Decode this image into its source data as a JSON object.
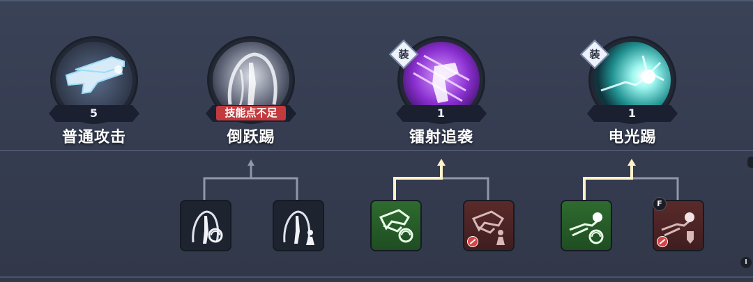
{
  "colors": {
    "background": "#373f53",
    "line_inactive": "#8f97a8",
    "line_active": "#fff2c8",
    "warning": "#c23a3d",
    "node_active": "#2e6b2f",
    "node_locked": "#5a2a2a"
  },
  "skills": [
    {
      "name": "普通攻击",
      "level": "5",
      "icon": "energy-gun-icon",
      "equipped": false
    },
    {
      "name": "倒跃踢",
      "status": "技能点不足",
      "icon": "backflip-kick-icon",
      "equipped": false
    },
    {
      "name": "镭射追袭",
      "level": "1",
      "icon": "laser-pursuit-icon",
      "equipped": true,
      "badge": "装"
    },
    {
      "name": "电光踢",
      "level": "1",
      "icon": "lightning-kick-icon",
      "equipped": true,
      "badge": "装"
    }
  ],
  "branches": [
    {
      "parent": "倒跃踢",
      "nodes": [
        {
          "icon": "backflip-kick-upgrade-icon",
          "state": "available"
        },
        {
          "icon": "backflip-kick-alt-icon",
          "state": "available"
        }
      ]
    },
    {
      "parent": "镭射追袭",
      "nodes": [
        {
          "icon": "laser-upgrade-icon",
          "state": "active"
        },
        {
          "icon": "laser-alt-icon",
          "state": "locked"
        }
      ]
    },
    {
      "parent": "电光踢",
      "nodes": [
        {
          "icon": "lightning-upgrade-icon",
          "state": "active"
        },
        {
          "icon": "lightning-alt-icon",
          "state": "locked",
          "key": "F"
        }
      ]
    }
  ],
  "side_buttons": [
    "I"
  ]
}
